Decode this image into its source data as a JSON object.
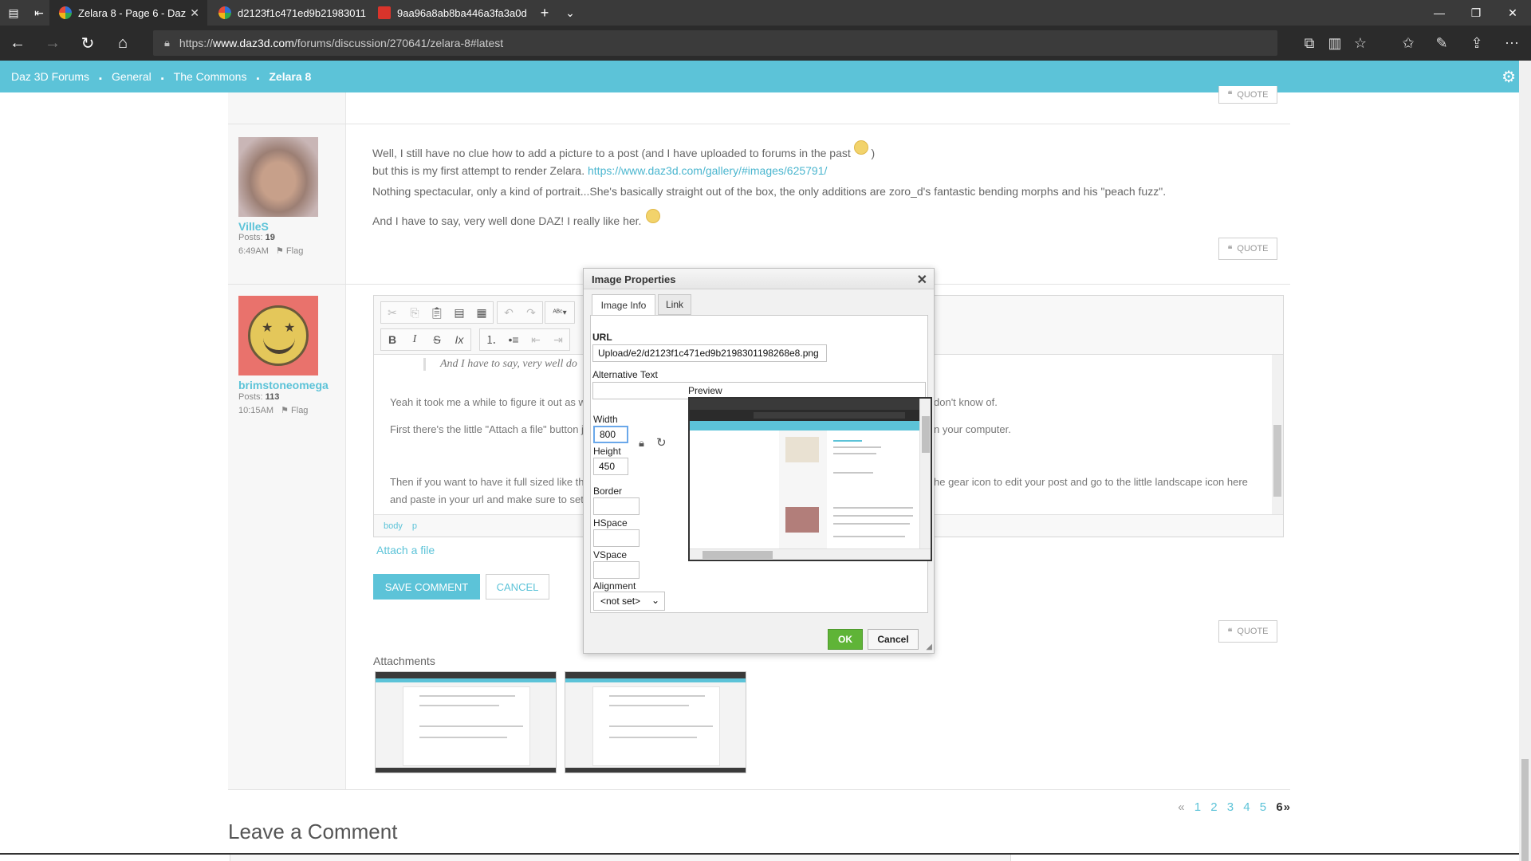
{
  "browser": {
    "tabs": [
      {
        "title": "Zelara 8 - Page 6 - Daz",
        "icon": "edge-icon",
        "active": true
      },
      {
        "title": "d2123f1c471ed9b21983011",
        "icon": "edge-icon",
        "active": false
      },
      {
        "title": "9aa96a8ab8ba446a3fa3a0d",
        "icon": "pdf-icon",
        "active": false
      }
    ],
    "url_prefix": "https://",
    "url_host": "www.daz3d.com",
    "url_path": "/forums/discussion/270641/zelara-8#latest"
  },
  "breadcrumb": {
    "items": [
      "Daz 3D Forums",
      "General",
      "The Commons"
    ],
    "current": "Zelara 8"
  },
  "posts": [
    {
      "username": "VilleS",
      "posts_label": "Posts:",
      "posts_count": "19",
      "time": "6:49AM",
      "flag": "Flag",
      "line1": "Well, I still have no clue how to add a picture to a post (and I have uploaded to forums in the past",
      "line1_end": ")",
      "line2_pre": "but this is my first attempt to render Zelara.",
      "line2_link": "https://www.daz3d.com/gallery/#images/625791/",
      "line3": "Nothing spectacular, only a kind of portrait...She's basically straight out of the box, the only additions are zoro_d's fantastic bending morphs and his \"peach fuzz\".",
      "line4": "And I have to say, very well done DAZ! I really like her."
    },
    {
      "username": "brimstoneomega",
      "posts_label": "Posts:",
      "posts_count": "113",
      "time": "10:15AM",
      "flag": "Flag"
    }
  ],
  "quote_label": "QUOTE",
  "editor": {
    "quote_text": "And I have to say, very well do",
    "para1_a": "Yeah it took me a while to figure it out as w",
    "para1_b": "don't know of.",
    "para2_a": "First there's the little \"Attach a file\" button j",
    "para2_b": "n your computer.",
    "para3_a": "Then if you want to have it full sized like th",
    "para3_b": "he gear icon to edit your post and go to the little landscape icon here",
    "para4_a": "and paste in your url and make sure to set",
    "status": [
      "body",
      "p"
    ]
  },
  "attach_link": "Attach a file",
  "save_comment": "SAVE COMMENT",
  "cancel": "CANCEL",
  "attachments_title": "Attachments",
  "pagination": {
    "prev": "«",
    "pages": [
      "1",
      "2",
      "3",
      "4",
      "5"
    ],
    "current": "6",
    "next": "»"
  },
  "leave_comment": "Leave a Comment",
  "dialog": {
    "title": "Image Properties",
    "tabs": [
      "Image Info",
      "Link"
    ],
    "url_label": "URL",
    "url_value": "Upload/e2/d2123f1c471ed9b2198301198268e8.png",
    "alt_label": "Alternative Text",
    "alt_value": "",
    "width_label": "Width",
    "width_value": "800",
    "height_label": "Height",
    "height_value": "450",
    "border_label": "Border",
    "hspace_label": "HSpace",
    "vspace_label": "VSpace",
    "alignment_label": "Alignment",
    "alignment_value": "<not set>",
    "preview_label": "Preview",
    "ok": "OK",
    "cancel": "Cancel"
  },
  "colors": {
    "accent": "#5cc3d8",
    "ok_green": "#5fb437"
  }
}
